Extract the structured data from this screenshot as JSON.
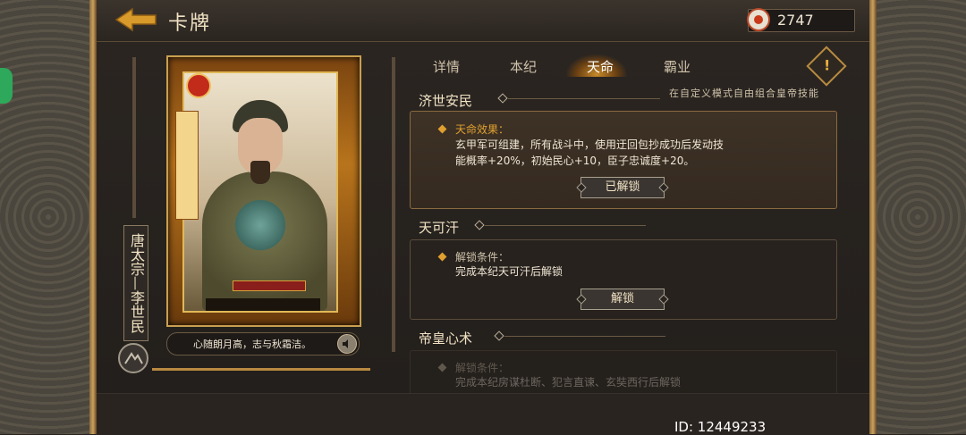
{
  "header": {
    "title": "卡牌",
    "currency_value": "2747"
  },
  "card": {
    "name_vertical": "唐太宗—李世民",
    "motto": "心随朗月高，志与秋霜洁。"
  },
  "tabs": [
    {
      "label": "详情"
    },
    {
      "label": "本纪"
    },
    {
      "label": "天命",
      "active": true
    },
    {
      "label": "霸业"
    }
  ],
  "hint": "在自定义模式自由组合皇帝技能",
  "sections": [
    {
      "title": "济世安民",
      "label": "天命效果：",
      "text_line1": "玄甲军可组建，所有战斗中，使用迂回包抄成功后发动技",
      "text_line2": "能概率+20%，初始民心+10，臣子忠诚度+20。",
      "button": "已解锁"
    },
    {
      "title": "天可汗",
      "label": "解锁条件：",
      "text_line1": "完成本纪天可汗后解锁",
      "button": "解锁"
    },
    {
      "title": "帝皇心术",
      "label": "解锁条件：",
      "text_line1": "完成本纪房谋杜断、犯言直谏、玄奘西行后解锁"
    }
  ],
  "footer": {
    "id": "ID: 12449233"
  },
  "colors": {
    "accent": "#e0a030",
    "text": "#f1e2c4",
    "panel_border": "#8a6a40"
  }
}
